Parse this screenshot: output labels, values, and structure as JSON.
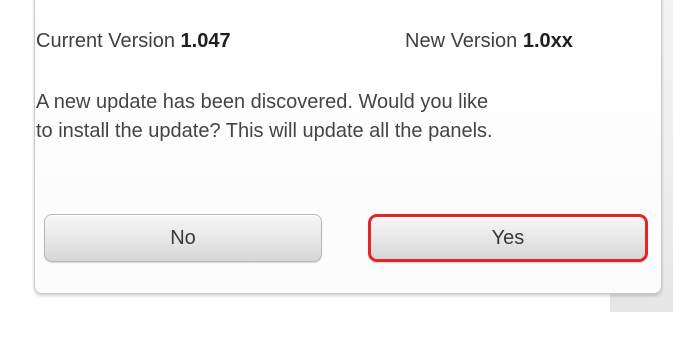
{
  "dialog": {
    "current_version_label": "Current Version",
    "current_version_value": "1.047",
    "new_version_label": "New Version",
    "new_version_value": "1.0xx",
    "message_line1": "A new update has been discovered. Would you like",
    "message_line2": "to install the update? This will update all the panels.",
    "no_label": "No",
    "yes_label": "Yes"
  },
  "colors": {
    "highlight_border": "#e0262d",
    "text": "#444444"
  }
}
